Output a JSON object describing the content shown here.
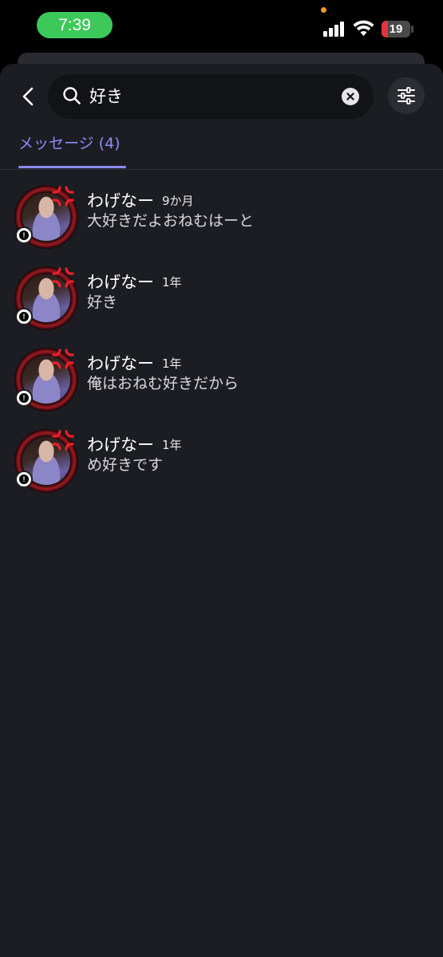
{
  "status_bar": {
    "time": "7:39",
    "battery_level": "19",
    "battery_color": "#e0343e"
  },
  "search": {
    "query": "好き",
    "search_icon": "search-icon",
    "clear_icon": "clear-icon",
    "back_icon": "chevron-left-icon",
    "filter_icon": "sliders-icon"
  },
  "tabs": [
    {
      "label": "メッセージ (4)",
      "active": true
    }
  ],
  "accent_color": "#8b8cf6",
  "results": [
    {
      "name": "わげなー",
      "time": "9か月",
      "preview": "大好きだよおねむはーと"
    },
    {
      "name": "わげなー",
      "time": "1年",
      "preview": "好き"
    },
    {
      "name": "わげなー",
      "time": "1年",
      "preview": "俺はおねむ好きだから"
    },
    {
      "name": "わげなー",
      "time": "1年",
      "preview": "め好きです"
    }
  ]
}
